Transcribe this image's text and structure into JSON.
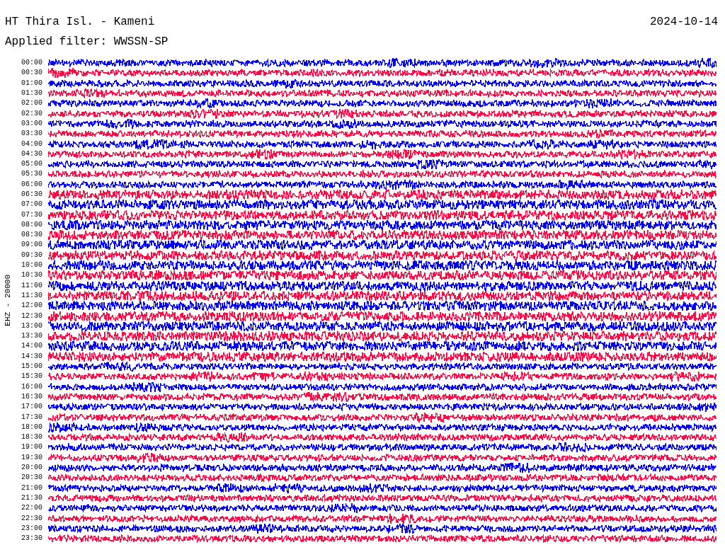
{
  "header": {
    "title": "HT Thira Isl. - Kameni",
    "filter": "Applied filter: WWSSN-SP",
    "date": "2024-10-14"
  },
  "axis_label": "EHZ - 20000",
  "rows": [
    {
      "time": "00:00",
      "color": "#0000ff"
    },
    {
      "time": "00:30",
      "color": "#ff0a45"
    },
    {
      "time": "01:00",
      "color": "#0000ff"
    },
    {
      "time": "01:30",
      "color": "#ff0a45"
    },
    {
      "time": "02:00",
      "color": "#0000ff"
    },
    {
      "time": "02:30",
      "color": "#ff0a45"
    },
    {
      "time": "03:00",
      "color": "#0000ff"
    },
    {
      "time": "03:30",
      "color": "#ff0a45"
    },
    {
      "time": "04:00",
      "color": "#0000ff"
    },
    {
      "time": "04:30",
      "color": "#ff0a45"
    },
    {
      "time": "05:00",
      "color": "#0000ff"
    },
    {
      "time": "05:30",
      "color": "#ff0a45"
    },
    {
      "time": "06:00",
      "color": "#0000ff"
    },
    {
      "time": "06:30",
      "color": "#ff0a45"
    },
    {
      "time": "07:00",
      "color": "#0000ff"
    },
    {
      "time": "07:30",
      "color": "#ff0a45"
    },
    {
      "time": "08:00",
      "color": "#0000ff"
    },
    {
      "time": "08:30",
      "color": "#ff0a45"
    },
    {
      "time": "09:00",
      "color": "#0000ff"
    },
    {
      "time": "09:30",
      "color": "#ff0a45"
    },
    {
      "time": "10:00",
      "color": "#0000ff"
    },
    {
      "time": "10:30",
      "color": "#ff0a45"
    },
    {
      "time": "11:00",
      "color": "#0000ff"
    },
    {
      "time": "11:30",
      "color": "#ff0a45"
    },
    {
      "time": "12:00",
      "color": "#0000ff"
    },
    {
      "time": "12:30",
      "color": "#ff0a45"
    },
    {
      "time": "13:00",
      "color": "#0000ff"
    },
    {
      "time": "13:30",
      "color": "#ff0a45"
    },
    {
      "time": "14:00",
      "color": "#0000ff"
    },
    {
      "time": "14:30",
      "color": "#ff0a45"
    },
    {
      "time": "15:00",
      "color": "#0000ff"
    },
    {
      "time": "15:30",
      "color": "#ff0a45"
    },
    {
      "time": "16:00",
      "color": "#0000ff"
    },
    {
      "time": "16:30",
      "color": "#ff0a45"
    },
    {
      "time": "17:00",
      "color": "#0000ff"
    },
    {
      "time": "17:30",
      "color": "#ff0a45"
    },
    {
      "time": "18:00",
      "color": "#0000ff"
    },
    {
      "time": "18:30",
      "color": "#ff0a45"
    },
    {
      "time": "19:00",
      "color": "#0000ff"
    },
    {
      "time": "19:30",
      "color": "#ff0a45"
    },
    {
      "time": "20:00",
      "color": "#0000ff"
    },
    {
      "time": "20:30",
      "color": "#ff0a45"
    },
    {
      "time": "21:00",
      "color": "#0000ff"
    },
    {
      "time": "21:30",
      "color": "#ff0a45"
    },
    {
      "time": "22:00",
      "color": "#0000ff"
    },
    {
      "time": "22:30",
      "color": "#ff0a45"
    },
    {
      "time": "23:00",
      "color": "#0000ff"
    },
    {
      "time": "23:30",
      "color": "#ff0a45"
    }
  ]
}
